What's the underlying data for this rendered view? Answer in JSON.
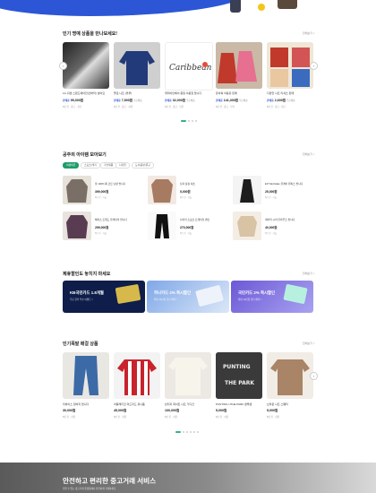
{
  "colors": {
    "accent": "#2c56d6",
    "green": "#1f9d6a"
  },
  "section1": {
    "title": "인기 명예 상품을 만나보세요!",
    "more": "전체보기 >",
    "items": [
      {
        "title": "LG 휘센 스탠드에어컨(인버터) 팔아요",
        "badge": "판매중",
        "price": "95,000원",
        "extra": "",
        "meta": "8분 전 · 중고 · 경기"
      },
      {
        "title": "폴로 니트 (블루)",
        "badge": "판매중",
        "price": "7,500원",
        "extra": "무료배송",
        "meta": "8분 전 · 중고 · 서울"
      },
      {
        "title": "캐리비안베이 종일 이용권 팝니다",
        "badge": "판매중",
        "price": "32,000원",
        "extra": "무료배송",
        "meta": "8분 전 · 중고 · 인천"
      },
      {
        "title": "유아복 아동옷 판매",
        "badge": "판매중",
        "price": "141,300원",
        "extra": "무료배송",
        "meta": "8분 전 · 중고 · 부산"
      },
      {
        "title": "다양한 니트 티셔츠 판매",
        "badge": "판매중",
        "price": "2,600원",
        "extra": "무료배송",
        "meta": "8분 전 · 중고 · 대구"
      }
    ]
  },
  "section2": {
    "title": "공주의 아이템 모아보기",
    "more": "전체보기 >",
    "chips": [
      "여성의류",
      "스포츠/레저",
      "가전제품",
      "디지털",
      "도서/음반/문구"
    ],
    "items": [
      {
        "title": "울 100% 롱 코트 남성 팝니다",
        "price": "399,000원",
        "meta": "8분 전 · 서울"
      },
      {
        "title": "남자 정장 셔츠",
        "price": "5,000원",
        "meta": "8분 전 · 서울"
      },
      {
        "title": "EIT MoCHalo 플레어 원피스 팝니다",
        "price": "25,000원",
        "meta": "8분 전 · 서울"
      },
      {
        "title": "헤리스 트위드 블레이저 팝니다",
        "price": "299,000원",
        "meta": "8분 전 · 서울"
      },
      {
        "title": "나이키 스포츠 트레이닝 팬츠",
        "price": "270,000원",
        "meta": "8분 전 · 서울"
      },
      {
        "title": "세라믹 시어 블라우스 팝니다",
        "price": "40,000원",
        "meta": "8분 전 · 서울"
      }
    ]
  },
  "section3": {
    "title": "제휴할인도 놓치지 마세요",
    "more": "전체보기 >",
    "banners": [
      {
        "t1": "KB국민카드 1.8개월",
        "t2": "무료 할부 우수 이벤트 >"
      },
      {
        "t1": "하나카드 2% 즉시할인",
        "t2": "최대 10만원 할인 혜택 >"
      },
      {
        "t1": "국민카드 2% 즉시할인",
        "t2": "최대 10만원 할인 혜택 >"
      }
    ]
  },
  "section4": {
    "title": "인기폭발 매걸 상품",
    "more": "전체보기 >",
    "items": [
      {
        "title": "리바이스 청바지 팝니다",
        "price": "30,000원",
        "meta": "8분 전 · 서울"
      },
      {
        "title": "아틀레티코 마드리드 유니폼",
        "price": "45,000원",
        "meta": "8분 전 · 서울"
      },
      {
        "title": "빈티지 화이트 니트 가디건",
        "price": "100,000원",
        "meta": "8분 전 · 서울"
      },
      {
        "title": "PUNTING UTHE PARK 맨투맨",
        "price": "5,000원",
        "meta": "8분 전 · 서울"
      },
      {
        "title": "브라운 니트 스웨터",
        "price": "5,000원",
        "meta": "8분 전 · 서울"
      }
    ]
  },
  "footer": {
    "title": "안전하고 편리한 중고거래 서비스",
    "subtitle": "믿을 수 있는 중고거래 플랫폼에서 안전하게 거래하세요"
  }
}
